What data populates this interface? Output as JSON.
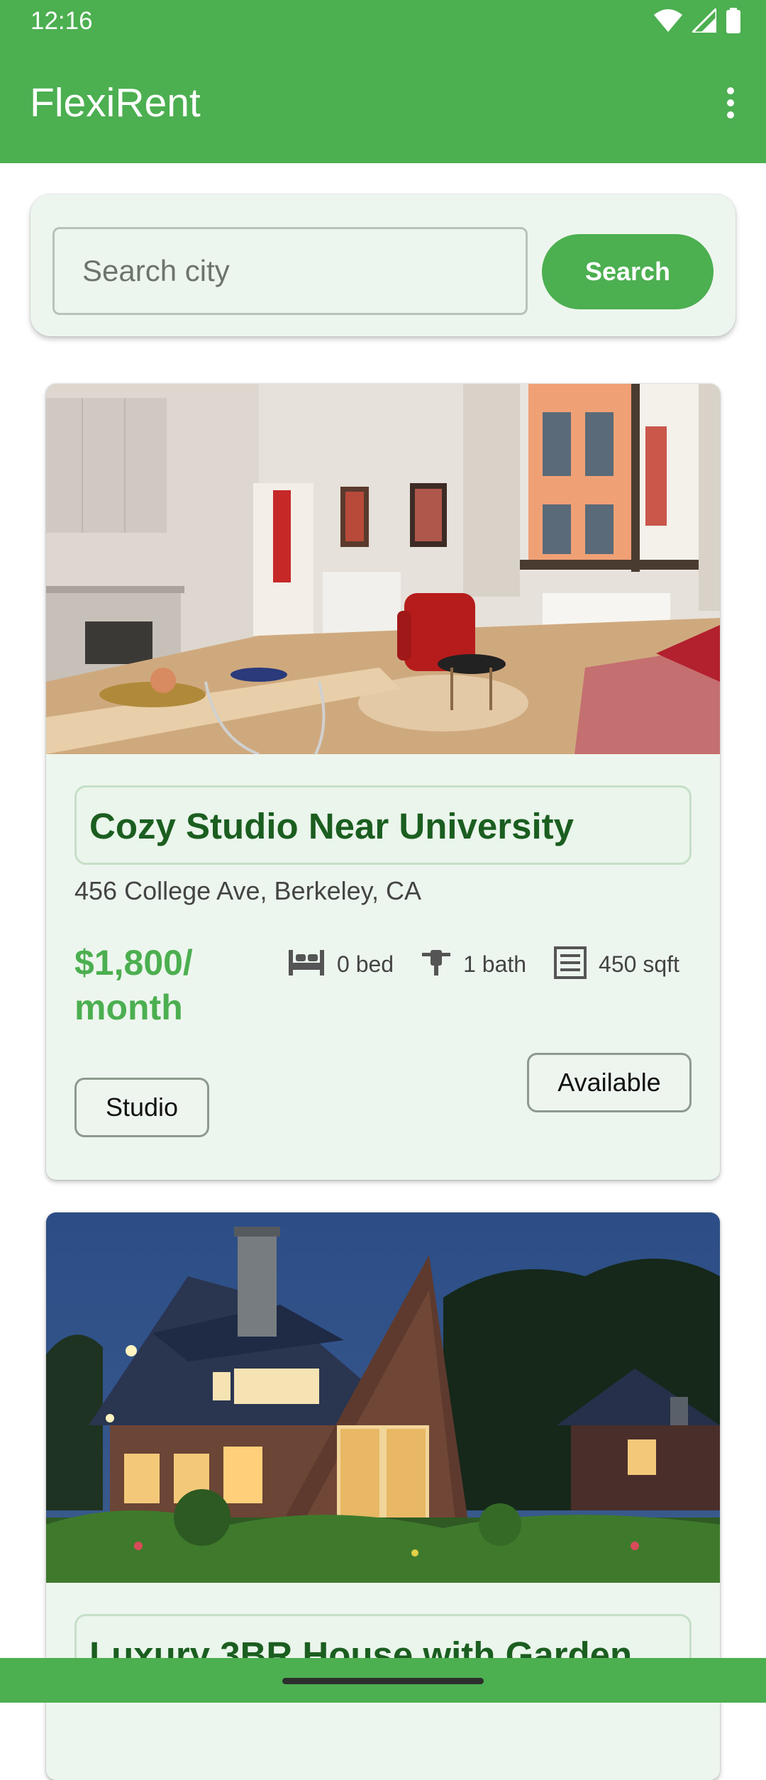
{
  "status_bar": {
    "time": "12:16",
    "icons": [
      "wifi-icon",
      "signal-icon",
      "battery-icon"
    ]
  },
  "app_bar": {
    "title": "FlexiRent",
    "menu_icon": "more-vert-icon"
  },
  "search": {
    "placeholder": "Search city",
    "value": "",
    "button_label": "Search"
  },
  "listings": [
    {
      "photo": "apartment-interior-photo",
      "title": "Cozy Studio Near University",
      "address": "456 College Ave, Berkeley, CA",
      "price": "$1,800/ month",
      "beds": "0 bed",
      "baths": "1 bath",
      "area": "450 sqft",
      "type": "Studio",
      "status": "Available"
    },
    {
      "photo": "house-exterior-photo",
      "title": "Luxury 3BR House with Garden"
    }
  ],
  "colors": {
    "primary": "#4caf50",
    "card_background": "#edf6ee",
    "title_text": "#1b5e20",
    "price_text": "#4caf50"
  }
}
